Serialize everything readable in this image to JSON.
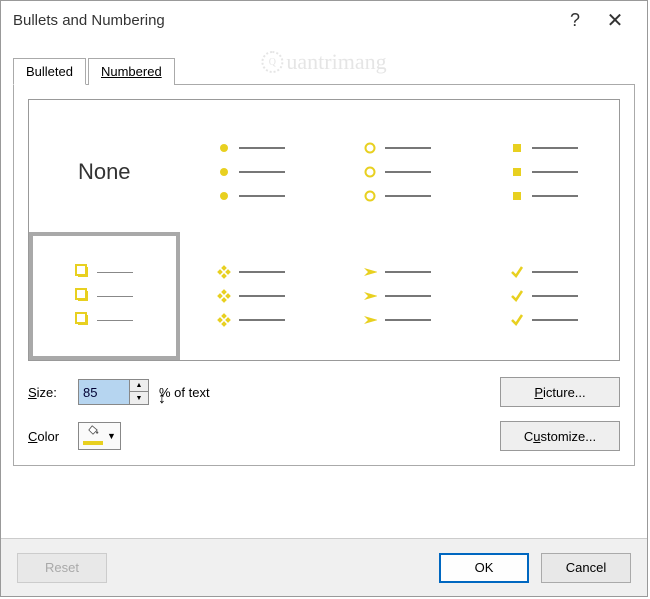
{
  "title": "Bullets and Numbering",
  "watermark": "uantrimang",
  "tabs": {
    "bulleted": "Bulleted",
    "numbered": "Numbered"
  },
  "gallery": {
    "none_label": "None",
    "styles": [
      "none",
      "disc",
      "circle",
      "square",
      "shadow-box",
      "diamond4",
      "arrow",
      "check"
    ]
  },
  "size": {
    "label": "Size:",
    "value": "85",
    "suffix": "% of text"
  },
  "color": {
    "label": "Color",
    "value": "#e8d020"
  },
  "buttons": {
    "picture": "Picture...",
    "customize": "Customize...",
    "reset": "Reset",
    "ok": "OK",
    "cancel": "Cancel"
  }
}
